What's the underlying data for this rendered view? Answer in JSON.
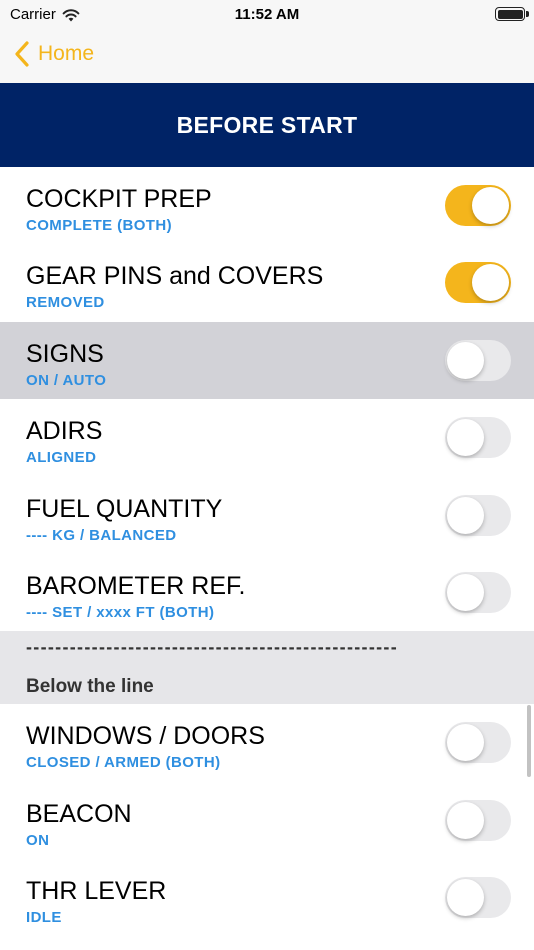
{
  "status": {
    "carrier": "Carrier",
    "time": "11:52 AM"
  },
  "nav": {
    "back_label": "Home",
    "back_icon": "chevron-left-icon"
  },
  "header": {
    "title": "BEFORE START"
  },
  "colors": {
    "accent": "#f4b51c",
    "header_bg": "#002366",
    "subtitle": "#2f8fe0",
    "selected_bg": "#d2d2d7",
    "section_bg": "#e6e6e9"
  },
  "items": [
    {
      "title": "COCKPIT PREP",
      "subtitle": "COMPLETE (BOTH)",
      "on": true
    },
    {
      "title": "GEAR PINS and COVERS",
      "subtitle": "REMOVED",
      "on": true
    },
    {
      "title": "SIGNS",
      "subtitle": "ON / AUTO",
      "on": false,
      "selected": true
    },
    {
      "title": "ADIRS",
      "subtitle": "ALIGNED",
      "on": false
    },
    {
      "title": "FUEL QUANTITY",
      "subtitle": "---- KG / BALANCED",
      "on": false
    },
    {
      "title": "BAROMETER REF.",
      "subtitle": "---- SET / xxxx FT (BOTH)",
      "on": false
    }
  ],
  "section": {
    "dashes": "---------------------------------------------------",
    "label": "Below the line"
  },
  "items_below": [
    {
      "title": "WINDOWS / DOORS",
      "subtitle": "CLOSED / ARMED (BOTH)",
      "on": false
    },
    {
      "title": "BEACON",
      "subtitle": "ON",
      "on": false
    },
    {
      "title": "THR LEVER",
      "subtitle": "IDLE",
      "on": false
    }
  ]
}
